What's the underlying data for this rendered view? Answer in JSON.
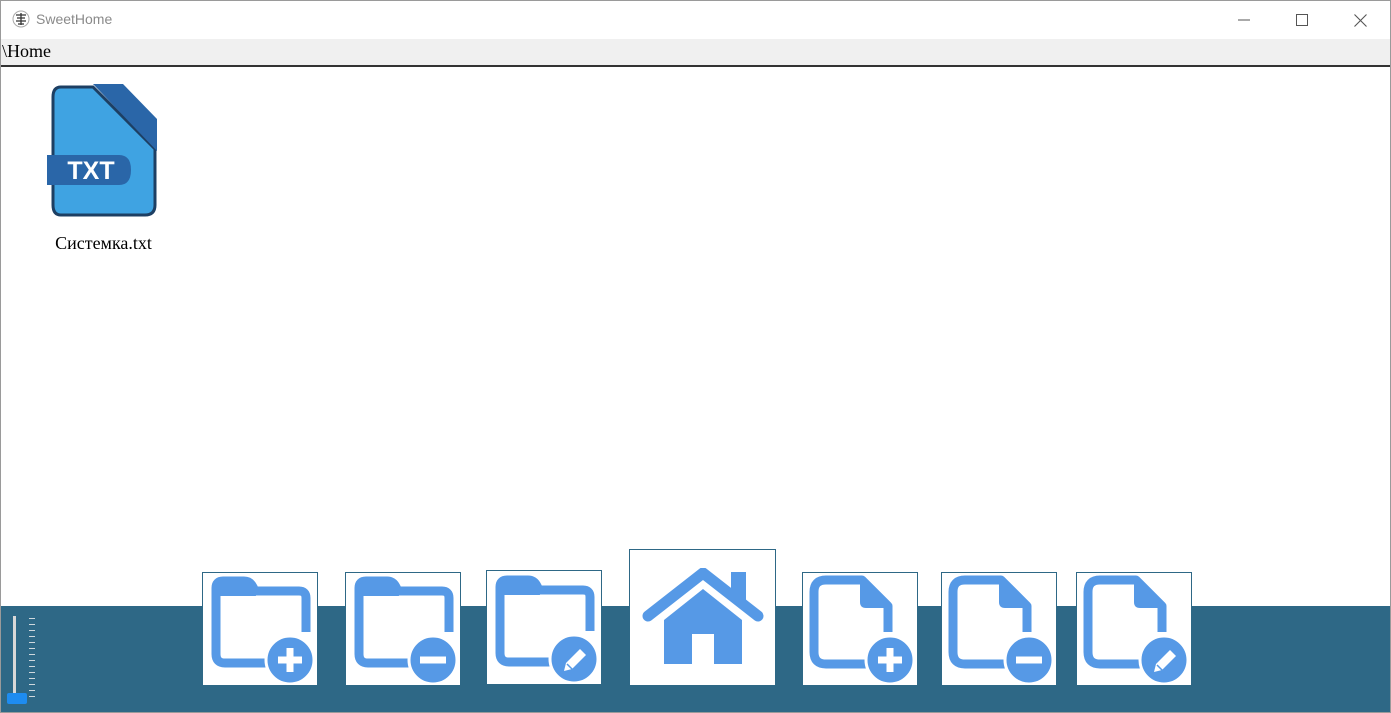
{
  "window": {
    "title": "SweetHome",
    "icon": "app-logo-icon",
    "controls": [
      "minimize-icon",
      "maximize-icon",
      "close-icon"
    ]
  },
  "pathbar": {
    "path": "\\Home"
  },
  "files": [
    {
      "name": "Системка.txt",
      "icon": "txt-file-icon",
      "icon_label": "TXT"
    }
  ],
  "toolbar": {
    "buttons": [
      {
        "name": "add-folder-button",
        "icon": "folder-add-icon"
      },
      {
        "name": "remove-folder-button",
        "icon": "folder-remove-icon"
      },
      {
        "name": "rename-folder-button",
        "icon": "folder-edit-icon"
      },
      {
        "name": "home-button",
        "icon": "home-icon"
      },
      {
        "name": "add-file-button",
        "icon": "file-add-icon"
      },
      {
        "name": "remove-file-button",
        "icon": "file-remove-icon"
      },
      {
        "name": "rename-file-button",
        "icon": "file-edit-icon"
      }
    ]
  },
  "slider": {
    "value_fraction": 0.0
  },
  "colors": {
    "accent": "#2e6886",
    "icon_blue": "#5699e6",
    "file_icon_blue": "#3fa3e2",
    "file_icon_dark": "#2a66a8",
    "slider_thumb": "#1e8cf0"
  }
}
